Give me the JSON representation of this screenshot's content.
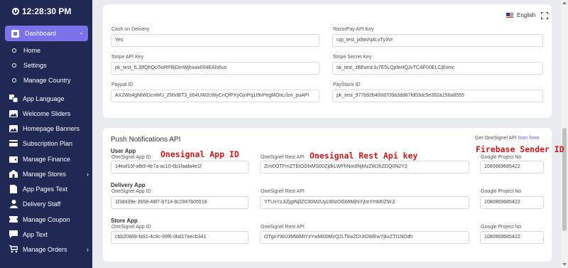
{
  "sidebar": {
    "clock": "12:28:30 PM",
    "dashboard": "Dashboard",
    "sub_items": [
      "Home",
      "Settings",
      "Manage Country"
    ],
    "items": [
      {
        "label": "App Language",
        "icon": "translate-icon"
      },
      {
        "label": "Welcome Sliders",
        "icon": "image-icon"
      },
      {
        "label": "Homepage Banners",
        "icon": "image-icon"
      },
      {
        "label": "Subscription Plan",
        "icon": "credit-card-icon"
      },
      {
        "label": "Manage Finance",
        "icon": "wallet-icon"
      },
      {
        "label": "Manage Stores",
        "icon": "store-icon",
        "has_submenu": true
      },
      {
        "label": "App Pages Text",
        "icon": "file-icon"
      },
      {
        "label": "Delivery Staff",
        "icon": "user-icon"
      },
      {
        "label": "Manage Coupon",
        "icon": "ticket-icon"
      },
      {
        "label": "App Text",
        "icon": "chat-icon"
      },
      {
        "label": "Manage Orders",
        "icon": "cart-icon",
        "has_submenu": true
      }
    ]
  },
  "header": {
    "language": "English"
  },
  "payment": {
    "cod": {
      "label": "Cash on Delivery",
      "value": "Yes"
    },
    "razorpay": {
      "label": "RazorPay API Key",
      "value": "rzp_test_jx9aVq4LvTy3Vr"
    },
    "stripe_api": {
      "label": "Stripe API Key",
      "value": "pk_test_fLJjtfQhQoTwRPBjDmWjhswx004EAls6uo"
    },
    "stripe_secret": {
      "label": "Stripe Secret Key",
      "value": "sk_test_zBEwnzJu7E5LQpfeHQJvTCAF00ELCjEvmc"
    },
    "paypal": {
      "label": "Paypal ID",
      "value": "AX2Ws4gNtWDcnWU_ZMxIBT3_b54UW2cWyCnQfPXyGjnPq1I9vPegMOnLrlzn_puAPl"
    },
    "paystack": {
      "label": "PayStack ID",
      "value": "pk_test_977b92b400d709a3dd67fd03dc5e392a156a8555"
    }
  },
  "push": {
    "title": "Push Notifications API",
    "get_text": "Get OneSignel API",
    "get_link": "from here",
    "sections": [
      {
        "title": "User App",
        "app_id_label": "OneSignel App ID",
        "app_id": "14eaf15f-afb9-4e7a-ac10-6b1faafa4e1f",
        "rest_label": "OneSignel Rest API",
        "rest": "ZmI0OTFmZTEtODIxMS00ZjdkLWFhNmItNjMzZWJhZDQ0N2Y2",
        "project_label": "Google Project No",
        "project": "1080869685422"
      },
      {
        "title": "Delivery App",
        "app_id_label": "OneSignel App ID",
        "app_id": "1f3d439e-3658-48f7-b714-8c2847b05518",
        "rest_label": "OneSignel Rest API",
        "rest": "YTUxYzJiZjgtNjllZC00M2UyLWIzOGMtMjhiYjImYmM0ZWJi",
        "project_label": "Google Project No",
        "project": "1080869685422"
      },
      {
        "title": "Store App",
        "app_id_label": "OneSignel App ID",
        "app_id": "cbb20889-fa91-4c9c-99f6-0bd17eecb341",
        "rest_label": "OneSignel Rest API",
        "rest": "OTgxYWU3MWMtYzYwMi00MzQ2LTkwZDUtOWEwYjkxZTI1NDdh",
        "project_label": "Google Project No",
        "project": "1080869685422"
      }
    ]
  },
  "annotations": {
    "app_id": "Onesignal App ID",
    "rest": "Onesignal Rest Api key",
    "sender": "Firebase Sender ID"
  },
  "colors": {
    "sidebar_bg": "#1f2954",
    "active": "#7b72e9",
    "annotation": "#d01818",
    "link": "#6b63d9"
  }
}
